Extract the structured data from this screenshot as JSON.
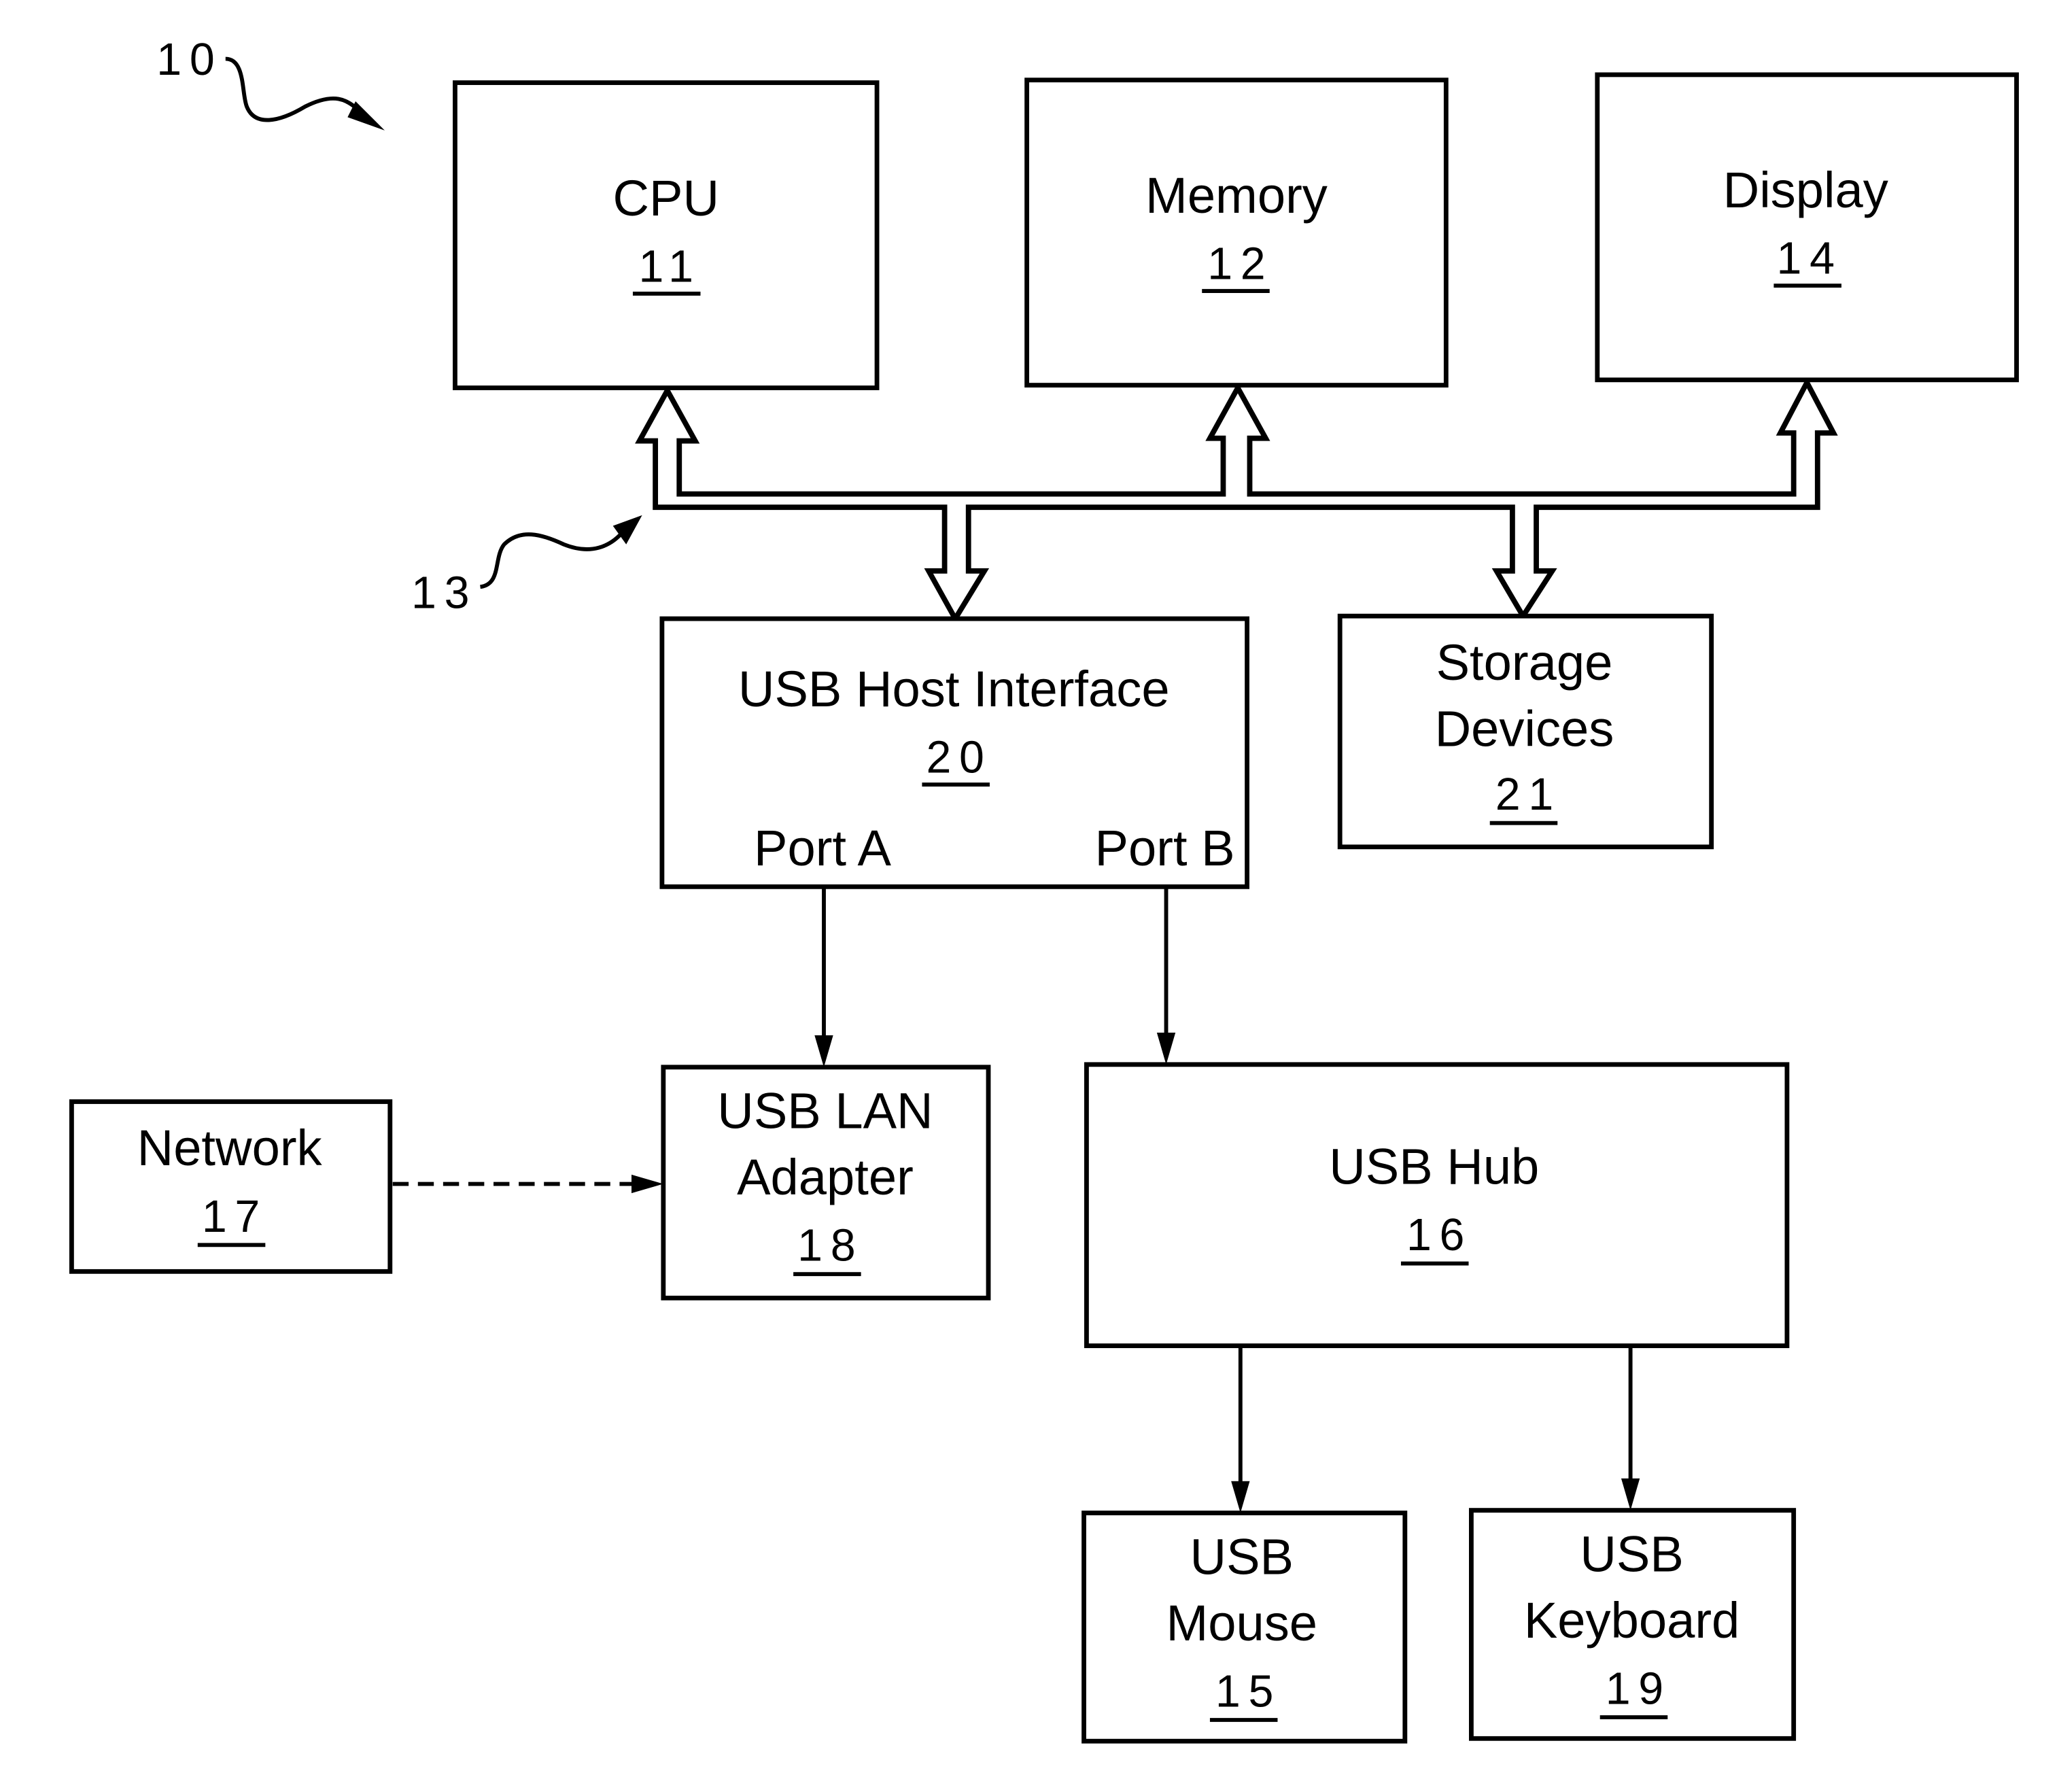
{
  "figure": {
    "reference": "10",
    "bus_reference": "13",
    "blocks": [
      {
        "id": "cpu",
        "lines": [
          "CPU"
        ],
        "number": "11"
      },
      {
        "id": "memory",
        "lines": [
          "Memory"
        ],
        "number": "12"
      },
      {
        "id": "display",
        "lines": [
          "Display"
        ],
        "number": "14"
      },
      {
        "id": "usb-host-interface",
        "lines": [
          "USB Host Interface"
        ],
        "number": "20",
        "ports": [
          "Port A",
          "Port B"
        ]
      },
      {
        "id": "storage-devices",
        "lines": [
          "Storage",
          "Devices"
        ],
        "number": "21"
      },
      {
        "id": "network",
        "lines": [
          "Network"
        ],
        "number": "17"
      },
      {
        "id": "usb-lan-adapter",
        "lines": [
          "USB LAN",
          "Adapter"
        ],
        "number": "18"
      },
      {
        "id": "usb-hub",
        "lines": [
          "USB Hub"
        ],
        "number": "16"
      },
      {
        "id": "usb-mouse",
        "lines": [
          "USB",
          "Mouse"
        ],
        "number": "15"
      },
      {
        "id": "usb-keyboard",
        "lines": [
          "USB",
          "Keyboard"
        ],
        "number": "19"
      }
    ]
  }
}
